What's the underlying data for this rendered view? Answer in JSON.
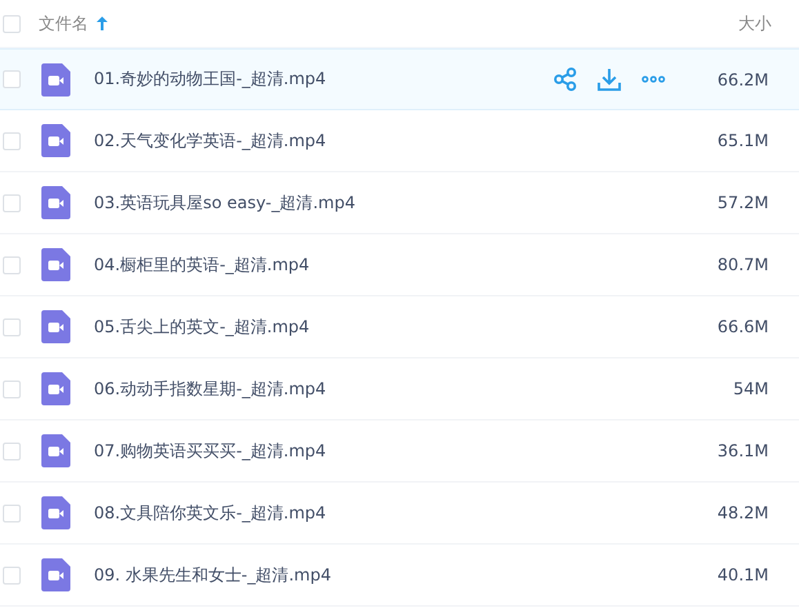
{
  "header": {
    "checked": false,
    "name_label": "文件名",
    "sort_ascending": true,
    "size_label": "大小"
  },
  "rows": [
    {
      "name": "01.奇妙的动物王国-_超清.mp4",
      "size": "66.2M",
      "checked": false,
      "highlighted": true
    },
    {
      "name": "02.天气变化学英语-_超清.mp4",
      "size": "65.1M",
      "checked": false,
      "highlighted": false
    },
    {
      "name": "03.英语玩具屋so easy-_超清.mp4",
      "size": "57.2M",
      "checked": false,
      "highlighted": false
    },
    {
      "name": "04.橱柜里的英语-_超清.mp4",
      "size": "80.7M",
      "checked": false,
      "highlighted": false
    },
    {
      "name": "05.舌尖上的英文-_超清.mp4",
      "size": "66.6M",
      "checked": false,
      "highlighted": false
    },
    {
      "name": "06.动动手指数星期-_超清.mp4",
      "size": "54M",
      "checked": false,
      "highlighted": false
    },
    {
      "name": "07.购物英语买买买-_超清.mp4",
      "size": "36.1M",
      "checked": false,
      "highlighted": false
    },
    {
      "name": "08.文具陪你英文乐-_超清.mp4",
      "size": "48.2M",
      "checked": false,
      "highlighted": false
    },
    {
      "name": "09. 水果先生和女士-_超清.mp4",
      "size": "40.1M",
      "checked": false,
      "highlighted": false
    }
  ]
}
